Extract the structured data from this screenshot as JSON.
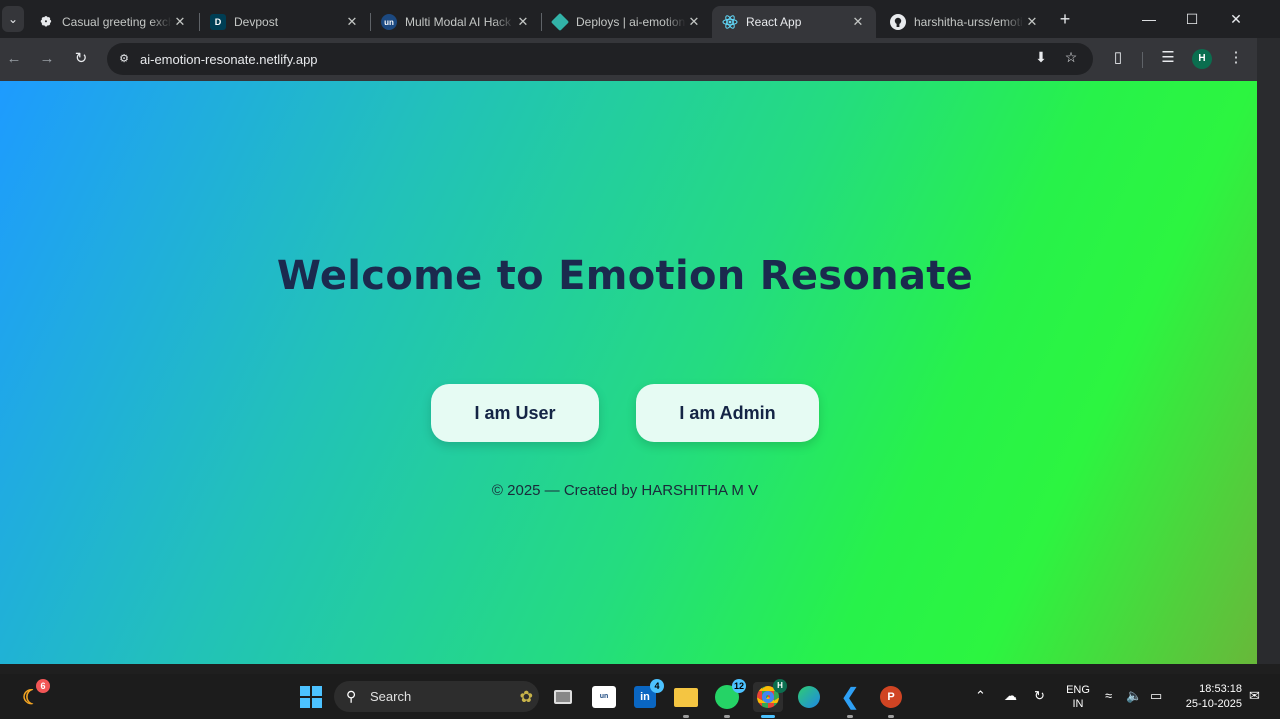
{
  "browser": {
    "tabs": [
      {
        "title": "Casual greeting exch",
        "favicon": "chatgpt-icon",
        "active": false
      },
      {
        "title": "Devpost",
        "favicon": "devpost-icon",
        "active": false
      },
      {
        "title": "Multi Modal AI Hack",
        "favicon": "unstop-icon",
        "active": false
      },
      {
        "title": "Deploys | ai-emotion",
        "favicon": "netlify-icon",
        "active": false
      },
      {
        "title": "React App",
        "favicon": "react-icon",
        "active": true
      },
      {
        "title": "harshitha-urss/emoti",
        "favicon": "github-icon",
        "active": false
      }
    ],
    "favicon_letters": {
      "devpost": "D",
      "unstop": "un"
    },
    "url": "ai-emotion-resonate.netlify.app",
    "profile_initial": "H"
  },
  "page": {
    "heading": "Welcome to Emotion Resonate",
    "user_button": "I am User",
    "admin_button": "I am Admin",
    "footer": "© 2025 — Created by HARSHITHA M V",
    "heading_color": "#1b2a4e",
    "button_bg": "#e6fbf3"
  },
  "taskbar": {
    "search_label": "Search",
    "badges": {
      "weather": "6",
      "linkedin": "4",
      "whatsapp": "12"
    },
    "chrome_profile": "H",
    "lang_line1": "ENG",
    "lang_line2": "IN",
    "time": "18:53:18",
    "date": "25-10-2025"
  }
}
